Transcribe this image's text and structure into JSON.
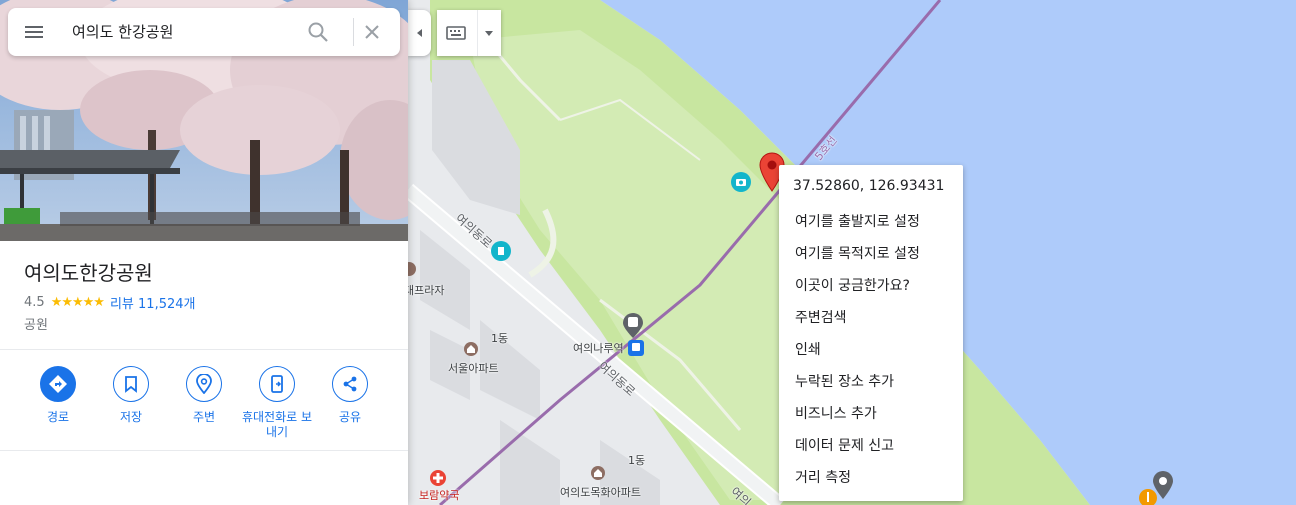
{
  "search": {
    "query": "여의도 한강공원"
  },
  "place": {
    "title": "여의도한강공원",
    "rating": "4.5",
    "stars": "★★★★★",
    "reviews": "리뷰 11,524개",
    "category": "공원"
  },
  "actions": [
    {
      "label": "경로"
    },
    {
      "label": "저장"
    },
    {
      "label": "주변"
    },
    {
      "label": "휴대전화로 보내기"
    },
    {
      "label": "공유"
    }
  ],
  "context_menu": {
    "coords": "37.52860, 126.93431",
    "items": [
      "여기를 출발지로 설정",
      "여기를 목적지로 설정",
      "이곳이 궁금한가요?",
      "주변검색",
      "인쇄",
      "누락된 장소 추가",
      "비즈니스 추가",
      "데이터 문제 신고",
      "거리 측정"
    ]
  },
  "map_labels": {
    "route": "5호선",
    "road1": "여의동로",
    "road2": "여의동로",
    "road3": "여의",
    "plaza": "대프라자",
    "building1": "1동",
    "building2": "1동",
    "apt1": "서울아파트",
    "station": "여의나루역",
    "pharmacy": "보람약국",
    "apt2": "여의도목화아파트"
  },
  "colors": {
    "accent": "#1a73e8",
    "water": "#aecbfa",
    "park": "#c8e6a0",
    "pin": "#ea4335",
    "subway": "#996cac"
  }
}
